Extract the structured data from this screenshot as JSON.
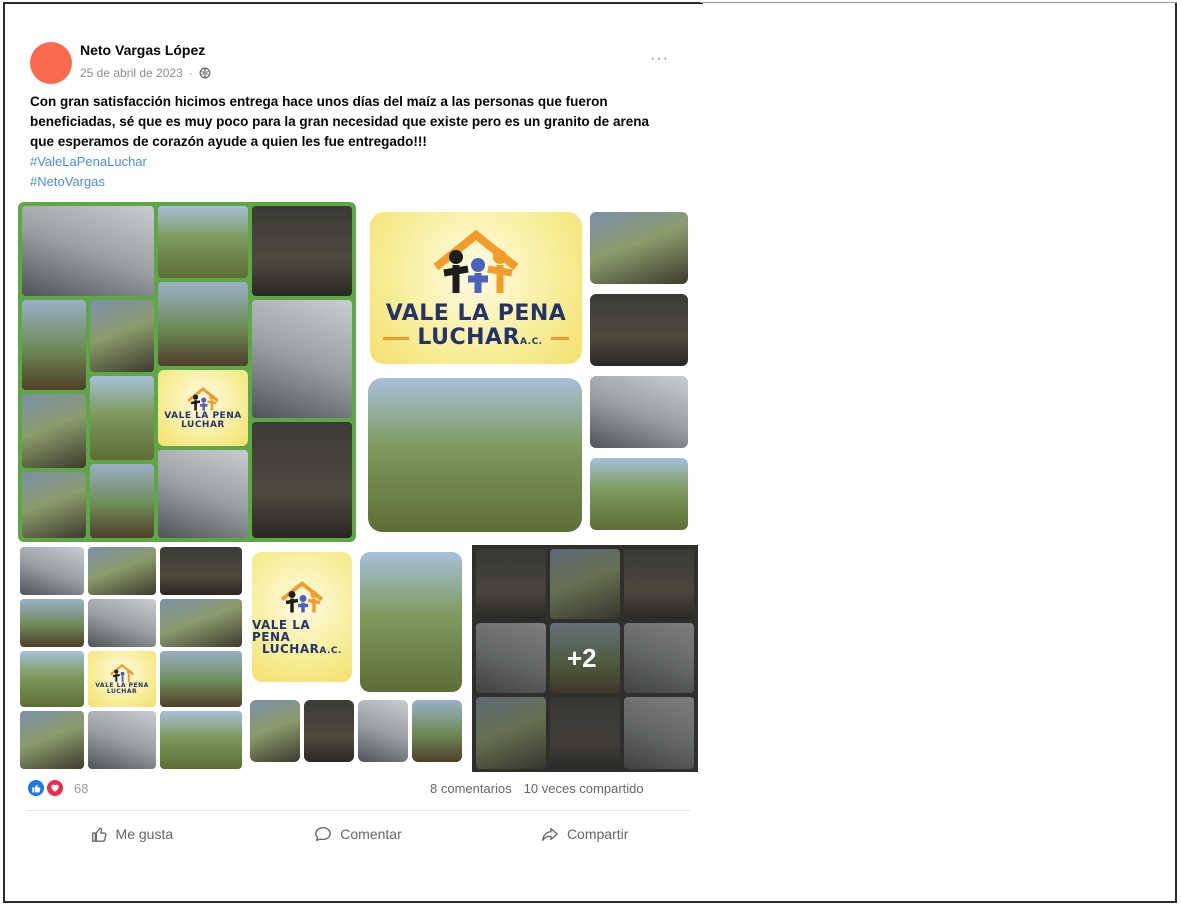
{
  "post": {
    "author": "Neto Vargas López",
    "date": "25 de abril de 2023",
    "more_label": "···",
    "text": "Con gran satisfacción hicimos entrega hace unos días del maíz a las personas que fueron beneficiadas, sé que es muy poco para la gran necesidad que existe pero es un granito de arena que esperamos de corazón ayude a quien les fue entregado!!!",
    "hashtags": [
      "#ValeLaPenaLuchar",
      "#NetoVargas"
    ],
    "avatar_color": "#fa6b4e",
    "link_color": "#4a8ef0"
  },
  "gallery": {
    "logo_line1": "VALE LA PENA",
    "logo_line2": "LUCHAR",
    "logo_suffix": "A.C.",
    "more_photos": "+2"
  },
  "engagement": {
    "reactions_count": "68",
    "comments": "8 comentarios",
    "shares": "10 veces compartido",
    "icons": [
      "like-icon",
      "love-icon"
    ]
  },
  "actions": {
    "like": "Me gusta",
    "comment": "Comentar",
    "share": "Compartir"
  }
}
